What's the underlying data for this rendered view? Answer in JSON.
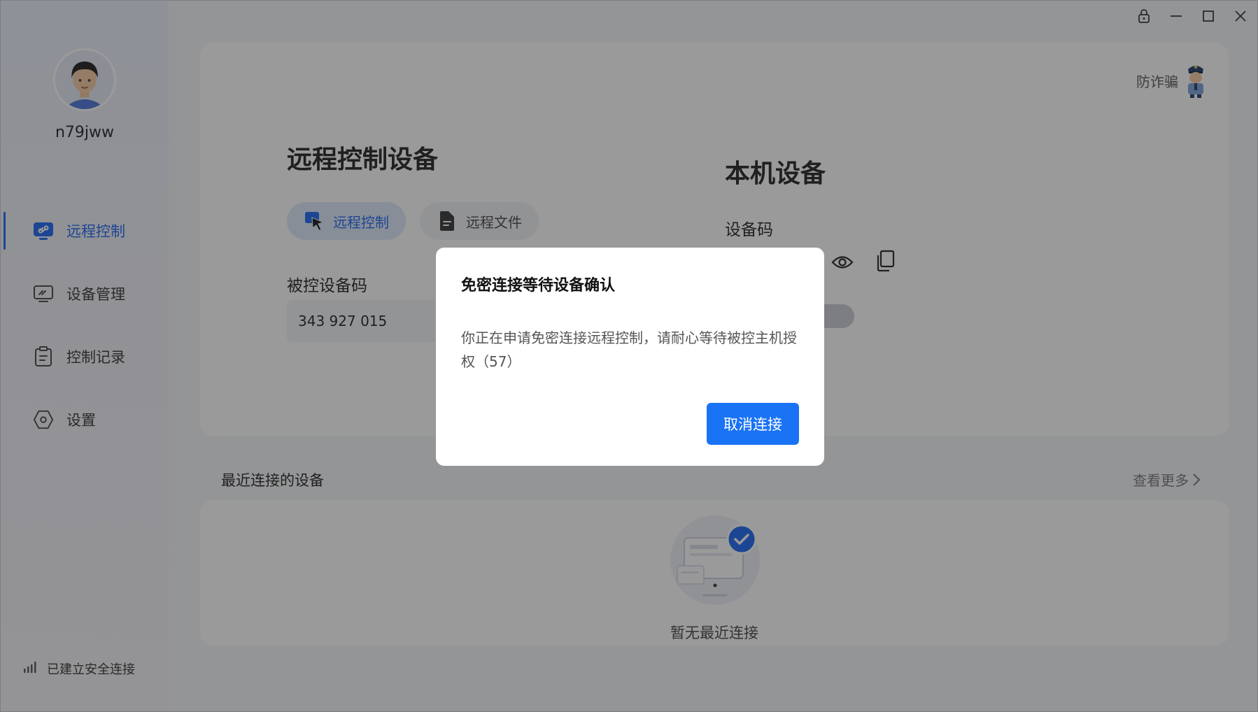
{
  "user": {
    "name": "n79jww"
  },
  "sidebar": {
    "items": [
      {
        "label": "远程控制",
        "icon": "remote-control-icon",
        "active": true
      },
      {
        "label": "设备管理",
        "icon": "monitor-icon",
        "active": false
      },
      {
        "label": "控制记录",
        "icon": "clipboard-icon",
        "active": false
      },
      {
        "label": "设置",
        "icon": "settings-icon",
        "active": false
      }
    ],
    "status": "已建立安全连接"
  },
  "header": {
    "fraud_label": "防诈骗"
  },
  "remote": {
    "title": "远程控制设备",
    "tabs": [
      {
        "label": "远程控制",
        "icon": "cursor-icon",
        "active": true
      },
      {
        "label": "远程文件",
        "icon": "file-icon",
        "active": false
      }
    ],
    "code_label": "被控设备码",
    "code_value": "343 927 015"
  },
  "local": {
    "title": "本机设备",
    "code_label": "设备码"
  },
  "recent": {
    "title": "最近连接的设备",
    "more": "查看更多",
    "empty": "暂无最近连接"
  },
  "dialog": {
    "title": "免密连接等待设备确认",
    "message": "你正在申请免密连接远程控制，请耐心等待被控主机授权（57）",
    "cancel": "取消连接"
  },
  "colors": {
    "accent": "#1a66f2",
    "button": "#1a73f5"
  }
}
